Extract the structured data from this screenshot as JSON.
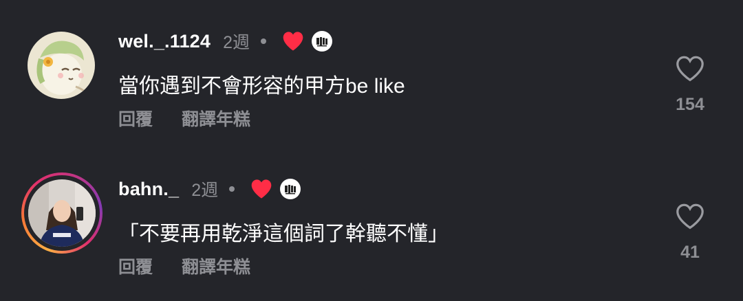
{
  "comments": [
    {
      "username": "wel._.1124",
      "time": "2週",
      "text": "當你遇到不會形容的甲方be like",
      "reply_label": "回覆",
      "translate_label": "翻譯年糕",
      "like_count": "154"
    },
    {
      "username": "bahn._",
      "time": "2週",
      "text": "「不要再用乾淨這個詞了幹聽不懂」",
      "reply_label": "回覆",
      "translate_label": "翻譯年糕",
      "like_count": "41"
    }
  ],
  "icons": {
    "liked_by_creator": "heart-icon",
    "like": "heart-outline-icon",
    "creator_avatar": "creator-avatar"
  },
  "colors": {
    "background": "#24252a",
    "primary_text": "#ffffff",
    "secondary_text": "#8e8f94",
    "liked_heart": "#ff2d46"
  }
}
